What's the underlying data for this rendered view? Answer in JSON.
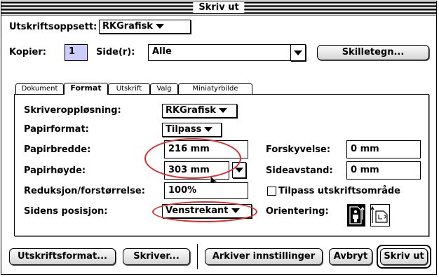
{
  "window": {
    "title": "Skriv ut"
  },
  "setup": {
    "label": "Utskriftsoppsett:",
    "value": "RKGrafisk"
  },
  "copies": {
    "label": "Kopier:",
    "value": "1"
  },
  "pages": {
    "label": "Side(r):",
    "value": "Alle"
  },
  "separator_button": {
    "label": "Skilletegn..."
  },
  "tabs": [
    "Dokument",
    "Format",
    "Utskrift",
    "Valg",
    "Miniatyrbilde"
  ],
  "active_tab": "Format",
  "format": {
    "resolution": {
      "label": "Skriveroppløsning:",
      "value": "RKGrafisk"
    },
    "paper_format": {
      "label": "Papirformat:",
      "value": "Tilpass"
    },
    "paper_width": {
      "label": "Papirbredde:",
      "value": "216 mm"
    },
    "paper_height": {
      "label": "Papirhøyde:",
      "value": "303 mm"
    },
    "scale": {
      "label": "Reduksjon/forstørrelse:",
      "value": "100%"
    },
    "page_position": {
      "label": "Sidens posisjon:",
      "value": "Venstrekant"
    },
    "offset": {
      "label": "Forskyvelse:",
      "value": "0 mm"
    },
    "page_gap": {
      "label": "Sideavstand:",
      "value": "0 mm"
    },
    "fit_print_area": {
      "label": "Tilpass utskriftsområde",
      "checked": false
    },
    "orientation": {
      "label": "Orientering:",
      "selected": "portrait"
    }
  },
  "buttons": {
    "page_setup": "Utskriftsformat...",
    "printer": "Skriver...",
    "save_settings": "Arkiver innstillinger",
    "cancel": "Avbryt",
    "print": "Skriv ut"
  },
  "annotation_color": "#e0282a"
}
